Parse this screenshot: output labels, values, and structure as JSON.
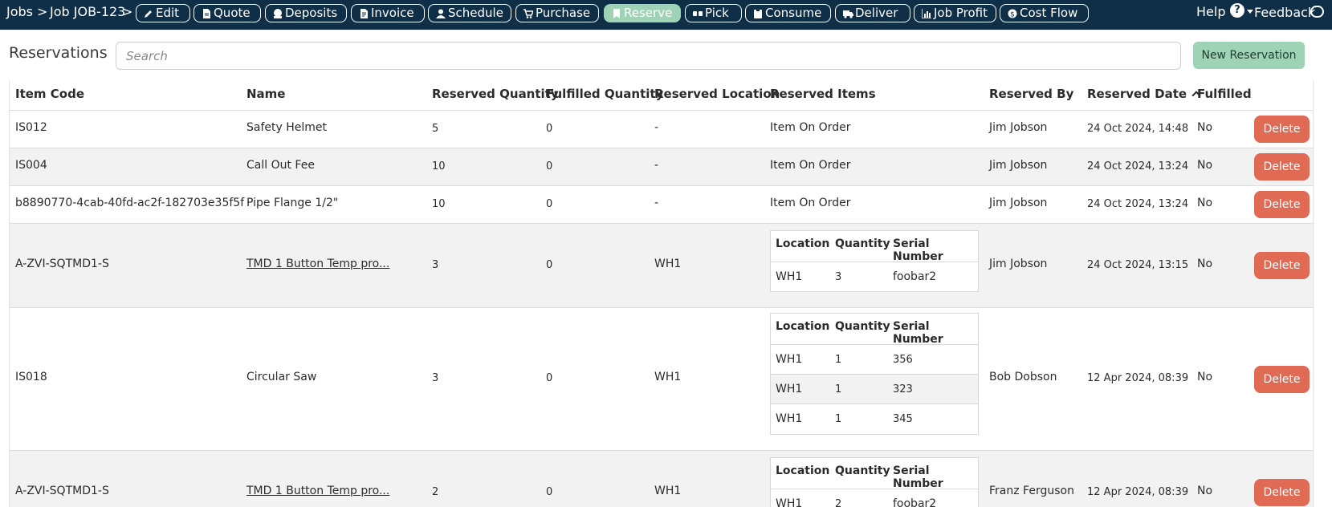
{
  "nav": {
    "breadcrumb": [
      "Jobs",
      ">",
      "Job JOB-123",
      ">"
    ],
    "tabs": [
      {
        "label": "Edit",
        "icon": "pencil-icon",
        "active": false
      },
      {
        "label": "Quote",
        "icon": "document-icon",
        "active": false
      },
      {
        "label": "Deposits",
        "icon": "coins-icon",
        "active": false
      },
      {
        "label": "Invoice",
        "icon": "invoice-icon",
        "active": false
      },
      {
        "label": "Schedule",
        "icon": "person-icon",
        "active": false
      },
      {
        "label": "Purchase",
        "icon": "cart-icon",
        "active": false
      },
      {
        "label": "Reserve",
        "icon": "bookmark-icon",
        "active": true
      },
      {
        "label": "Pick",
        "icon": "hands-icon",
        "active": false
      },
      {
        "label": "Consume",
        "icon": "clipboard-icon",
        "active": false
      },
      {
        "label": "Deliver",
        "icon": "truck-icon",
        "active": false
      },
      {
        "label": "Job Profit",
        "icon": "bar-chart-icon",
        "active": false
      },
      {
        "label": "Cost Flow",
        "icon": "money-flow-icon",
        "active": false
      }
    ],
    "help_label": "Help",
    "help_glyph": "?",
    "feedback_label": "Feedback"
  },
  "page": {
    "title": "Reservations",
    "search_placeholder": "Search",
    "new_button_label": "New Reservation"
  },
  "table": {
    "columns": [
      "Item Code",
      "Name",
      "Reserved Quantity",
      "Fulfilled Quantity",
      "Reserved Location",
      "Reserved Items",
      "Reserved By",
      "Reserved Date",
      "Fulfilled"
    ],
    "sorted_column": "Reserved Date",
    "sort_direction": "ascending",
    "delete_label": "Delete",
    "subtable_columns": [
      "Location",
      "Quantity",
      "Serial Number"
    ],
    "rows": [
      {
        "item_code": "IS012",
        "name": "Safety Helmet",
        "name_link": false,
        "reserved_qty": "5",
        "fulfilled_qty": "0",
        "location": "-",
        "reserved_items": "Item On Order",
        "sub_items": [],
        "reserved_by": "Jim Jobson",
        "date": "24 Oct 2024, 14:48",
        "fulfilled": "No"
      },
      {
        "item_code": "IS004",
        "name": "Call Out Fee",
        "name_link": false,
        "reserved_qty": "10",
        "fulfilled_qty": "0",
        "location": "-",
        "reserved_items": "Item On Order",
        "sub_items": [],
        "reserved_by": "Jim Jobson",
        "date": "24 Oct 2024, 13:24",
        "fulfilled": "No"
      },
      {
        "item_code": "b8890770-4cab-40fd-ac2f-182703e35f5f",
        "name": "Pipe Flange 1/2\"",
        "name_link": false,
        "reserved_qty": "10",
        "fulfilled_qty": "0",
        "location": "-",
        "reserved_items": "Item On Order",
        "sub_items": [],
        "reserved_by": "Jim Jobson",
        "date": "24 Oct 2024, 13:24",
        "fulfilled": "No"
      },
      {
        "item_code": "A-ZVI-SQTMD1-S",
        "name": "TMD 1 Button Temp pro...",
        "name_link": true,
        "reserved_qty": "3",
        "fulfilled_qty": "0",
        "location": "WH1",
        "reserved_items": "",
        "sub_items": [
          {
            "location": "WH1",
            "quantity": "3",
            "serial": "foobar2"
          }
        ],
        "reserved_by": "Jim Jobson",
        "date": "24 Oct 2024, 13:15",
        "fulfilled": "No"
      },
      {
        "item_code": "IS018",
        "name": "Circular Saw",
        "name_link": false,
        "reserved_qty": "3",
        "fulfilled_qty": "0",
        "location": "WH1",
        "reserved_items": "",
        "sub_items": [
          {
            "location": "WH1",
            "quantity": "1",
            "serial": "356"
          },
          {
            "location": "WH1",
            "quantity": "1",
            "serial": "323"
          },
          {
            "location": "WH1",
            "quantity": "1",
            "serial": "345"
          }
        ],
        "reserved_by": "Bob Dobson",
        "date": "12 Apr 2024, 08:39",
        "fulfilled": "No"
      },
      {
        "item_code": "A-ZVI-SQTMD1-S",
        "name": "TMD 1 Button Temp pro...",
        "name_link": true,
        "reserved_qty": "2",
        "fulfilled_qty": "0",
        "location": "WH1",
        "reserved_items": "",
        "sub_items": [
          {
            "location": "WH1",
            "quantity": "2",
            "serial": "foobar2"
          }
        ],
        "reserved_by": "Franz Ferguson",
        "date": "12 Apr 2024, 08:39",
        "fulfilled": "No"
      }
    ]
  },
  "colors": {
    "nav_bg": "#0f2f48",
    "active_tab": "#9fd3b6",
    "delete_button": "#e06a53",
    "alt_row": "#f2f2f2"
  }
}
